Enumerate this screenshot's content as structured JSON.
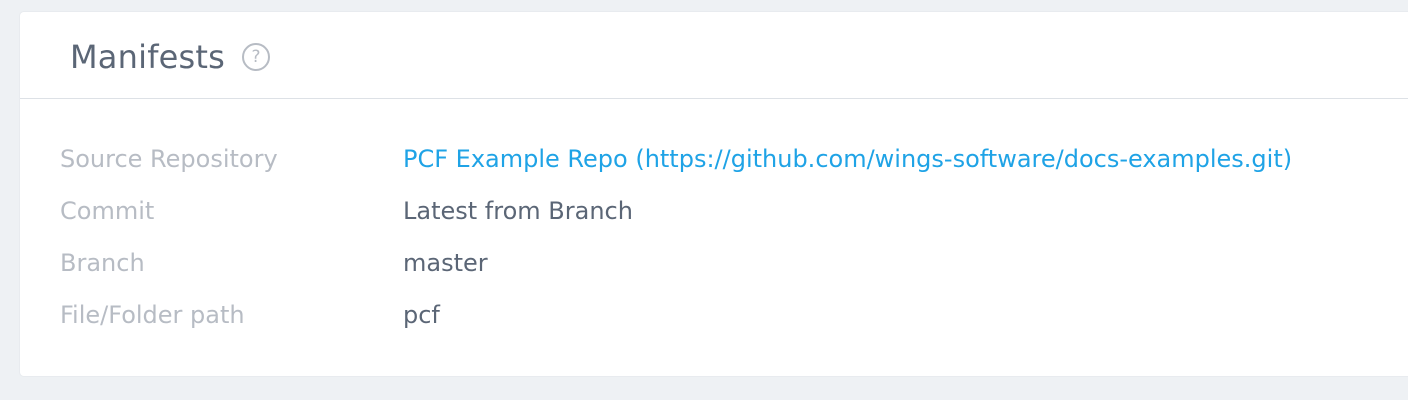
{
  "panel": {
    "title": "Manifests",
    "help_icon": "question-circle-icon",
    "help_symbol": "?"
  },
  "fields": [
    {
      "label": "Source Repository",
      "value": "PCF Example Repo (https://github.com/wings-software/docs-examples.git)"
    },
    {
      "label": "Commit",
      "value": "Latest from Branch"
    },
    {
      "label": "Branch",
      "value": "master"
    },
    {
      "label": "File/Folder path",
      "value": "pcf"
    }
  ],
  "colors": {
    "background": "#eef1f4",
    "card": "#ffffff",
    "title": "#5b6676",
    "label": "#b7bcc4",
    "value": "#5b6676",
    "link": "#1fa3e6"
  }
}
